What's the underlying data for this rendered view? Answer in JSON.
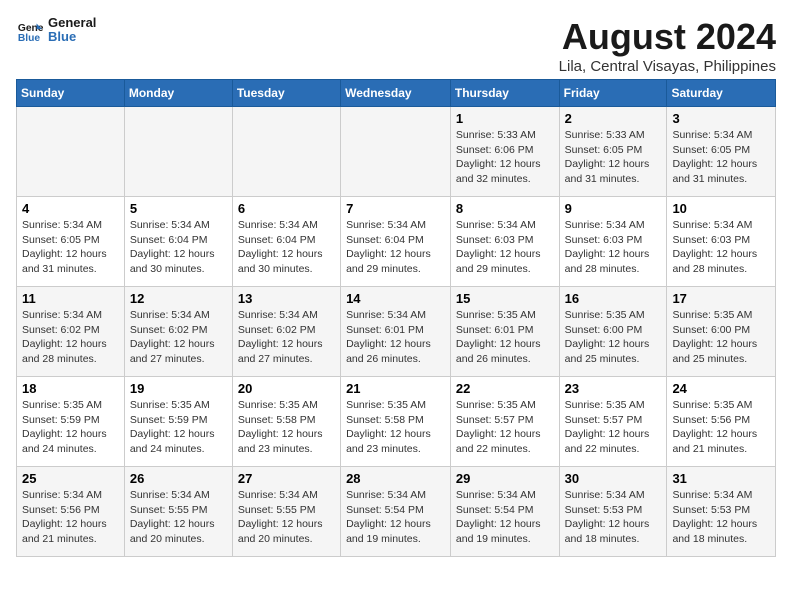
{
  "header": {
    "logo_line1": "General",
    "logo_line2": "Blue",
    "title": "August 2024",
    "subtitle": "Lila, Central Visayas, Philippines"
  },
  "weekdays": [
    "Sunday",
    "Monday",
    "Tuesday",
    "Wednesday",
    "Thursday",
    "Friday",
    "Saturday"
  ],
  "weeks": [
    [
      {
        "day": "",
        "info": ""
      },
      {
        "day": "",
        "info": ""
      },
      {
        "day": "",
        "info": ""
      },
      {
        "day": "",
        "info": ""
      },
      {
        "day": "1",
        "info": "Sunrise: 5:33 AM\nSunset: 6:06 PM\nDaylight: 12 hours\nand 32 minutes."
      },
      {
        "day": "2",
        "info": "Sunrise: 5:33 AM\nSunset: 6:05 PM\nDaylight: 12 hours\nand 31 minutes."
      },
      {
        "day": "3",
        "info": "Sunrise: 5:34 AM\nSunset: 6:05 PM\nDaylight: 12 hours\nand 31 minutes."
      }
    ],
    [
      {
        "day": "4",
        "info": "Sunrise: 5:34 AM\nSunset: 6:05 PM\nDaylight: 12 hours\nand 31 minutes."
      },
      {
        "day": "5",
        "info": "Sunrise: 5:34 AM\nSunset: 6:04 PM\nDaylight: 12 hours\nand 30 minutes."
      },
      {
        "day": "6",
        "info": "Sunrise: 5:34 AM\nSunset: 6:04 PM\nDaylight: 12 hours\nand 30 minutes."
      },
      {
        "day": "7",
        "info": "Sunrise: 5:34 AM\nSunset: 6:04 PM\nDaylight: 12 hours\nand 29 minutes."
      },
      {
        "day": "8",
        "info": "Sunrise: 5:34 AM\nSunset: 6:03 PM\nDaylight: 12 hours\nand 29 minutes."
      },
      {
        "day": "9",
        "info": "Sunrise: 5:34 AM\nSunset: 6:03 PM\nDaylight: 12 hours\nand 28 minutes."
      },
      {
        "day": "10",
        "info": "Sunrise: 5:34 AM\nSunset: 6:03 PM\nDaylight: 12 hours\nand 28 minutes."
      }
    ],
    [
      {
        "day": "11",
        "info": "Sunrise: 5:34 AM\nSunset: 6:02 PM\nDaylight: 12 hours\nand 28 minutes."
      },
      {
        "day": "12",
        "info": "Sunrise: 5:34 AM\nSunset: 6:02 PM\nDaylight: 12 hours\nand 27 minutes."
      },
      {
        "day": "13",
        "info": "Sunrise: 5:34 AM\nSunset: 6:02 PM\nDaylight: 12 hours\nand 27 minutes."
      },
      {
        "day": "14",
        "info": "Sunrise: 5:34 AM\nSunset: 6:01 PM\nDaylight: 12 hours\nand 26 minutes."
      },
      {
        "day": "15",
        "info": "Sunrise: 5:35 AM\nSunset: 6:01 PM\nDaylight: 12 hours\nand 26 minutes."
      },
      {
        "day": "16",
        "info": "Sunrise: 5:35 AM\nSunset: 6:00 PM\nDaylight: 12 hours\nand 25 minutes."
      },
      {
        "day": "17",
        "info": "Sunrise: 5:35 AM\nSunset: 6:00 PM\nDaylight: 12 hours\nand 25 minutes."
      }
    ],
    [
      {
        "day": "18",
        "info": "Sunrise: 5:35 AM\nSunset: 5:59 PM\nDaylight: 12 hours\nand 24 minutes."
      },
      {
        "day": "19",
        "info": "Sunrise: 5:35 AM\nSunset: 5:59 PM\nDaylight: 12 hours\nand 24 minutes."
      },
      {
        "day": "20",
        "info": "Sunrise: 5:35 AM\nSunset: 5:58 PM\nDaylight: 12 hours\nand 23 minutes."
      },
      {
        "day": "21",
        "info": "Sunrise: 5:35 AM\nSunset: 5:58 PM\nDaylight: 12 hours\nand 23 minutes."
      },
      {
        "day": "22",
        "info": "Sunrise: 5:35 AM\nSunset: 5:57 PM\nDaylight: 12 hours\nand 22 minutes."
      },
      {
        "day": "23",
        "info": "Sunrise: 5:35 AM\nSunset: 5:57 PM\nDaylight: 12 hours\nand 22 minutes."
      },
      {
        "day": "24",
        "info": "Sunrise: 5:35 AM\nSunset: 5:56 PM\nDaylight: 12 hours\nand 21 minutes."
      }
    ],
    [
      {
        "day": "25",
        "info": "Sunrise: 5:34 AM\nSunset: 5:56 PM\nDaylight: 12 hours\nand 21 minutes."
      },
      {
        "day": "26",
        "info": "Sunrise: 5:34 AM\nSunset: 5:55 PM\nDaylight: 12 hours\nand 20 minutes."
      },
      {
        "day": "27",
        "info": "Sunrise: 5:34 AM\nSunset: 5:55 PM\nDaylight: 12 hours\nand 20 minutes."
      },
      {
        "day": "28",
        "info": "Sunrise: 5:34 AM\nSunset: 5:54 PM\nDaylight: 12 hours\nand 19 minutes."
      },
      {
        "day": "29",
        "info": "Sunrise: 5:34 AM\nSunset: 5:54 PM\nDaylight: 12 hours\nand 19 minutes."
      },
      {
        "day": "30",
        "info": "Sunrise: 5:34 AM\nSunset: 5:53 PM\nDaylight: 12 hours\nand 18 minutes."
      },
      {
        "day": "31",
        "info": "Sunrise: 5:34 AM\nSunset: 5:53 PM\nDaylight: 12 hours\nand 18 minutes."
      }
    ]
  ]
}
